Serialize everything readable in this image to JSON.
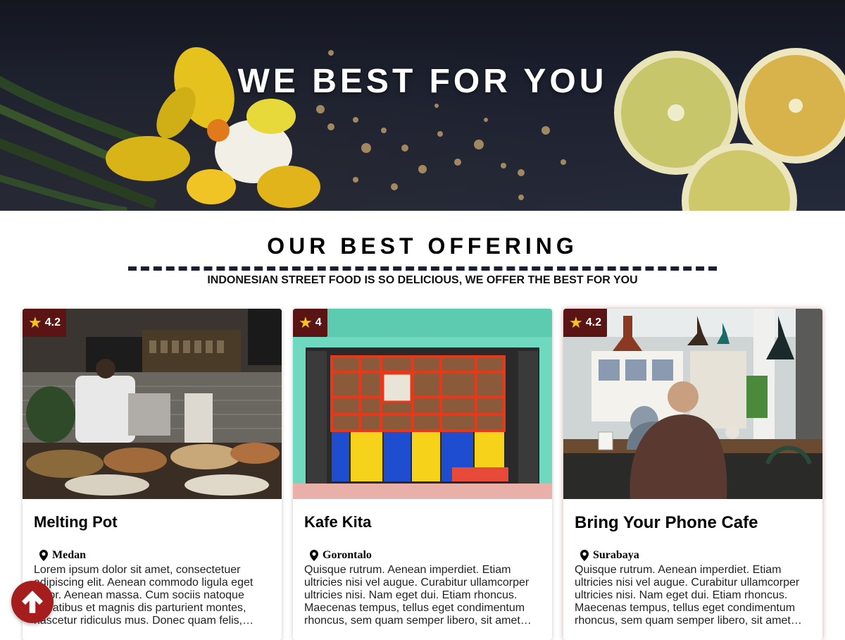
{
  "hero": {
    "title": "WE BEST FOR YOU"
  },
  "section": {
    "title": "OUR BEST OFFERING",
    "subtitle": "INDONESIAN STREET FOOD IS SO DELICIOUS, WE OFFER THE BEST FOR YOU"
  },
  "cards": [
    {
      "rating": "4.2",
      "name": "Melting Pot",
      "location": "Medan",
      "description": "Lorem ipsum dolor sit amet, consectetuer adipiscing elit. Aenean commodo ligula eget dolor. Aenean massa. Cum sociis natoque penatibus et magnis dis parturient montes, nascetur ridiculus mus. Donec quam felis, ultricies nec, pellentesque eu, pretium quis, sem."
    },
    {
      "rating": "4",
      "name": "Kafe Kita",
      "location": "Gorontalo",
      "description": "Quisque rutrum. Aenean imperdiet. Etiam ultricies nisi vel augue. Curabitur ullamcorper ultricies nisi. Nam eget dui. Etiam rhoncus. Maecenas tempus, tellus eget condimentum rhoncus, sem quam semper libero, sit amet adipiscing sem neque sed ipsum."
    },
    {
      "rating": "4.2",
      "name": "Bring Your Phone Cafe",
      "location": "Surabaya",
      "description": "Quisque rutrum. Aenean imperdiet. Etiam ultricies nisi vel augue. Curabitur ullamcorper ultricies nisi. Nam eget dui. Etiam rhoncus. Maecenas tempus, tellus eget condimentum rhoncus, sem quam semper libero, sit amet adipiscing sem neque sed ipsum."
    }
  ],
  "icons": {
    "rating": "star-icon",
    "location": "map-pin-icon",
    "scroll_top": "arrow-up-icon"
  },
  "colors": {
    "badge_bg": "#5a1414",
    "star": "#f6c31a",
    "scroll_top_bg": "#a51d1d",
    "divider": "#1a1f33"
  }
}
